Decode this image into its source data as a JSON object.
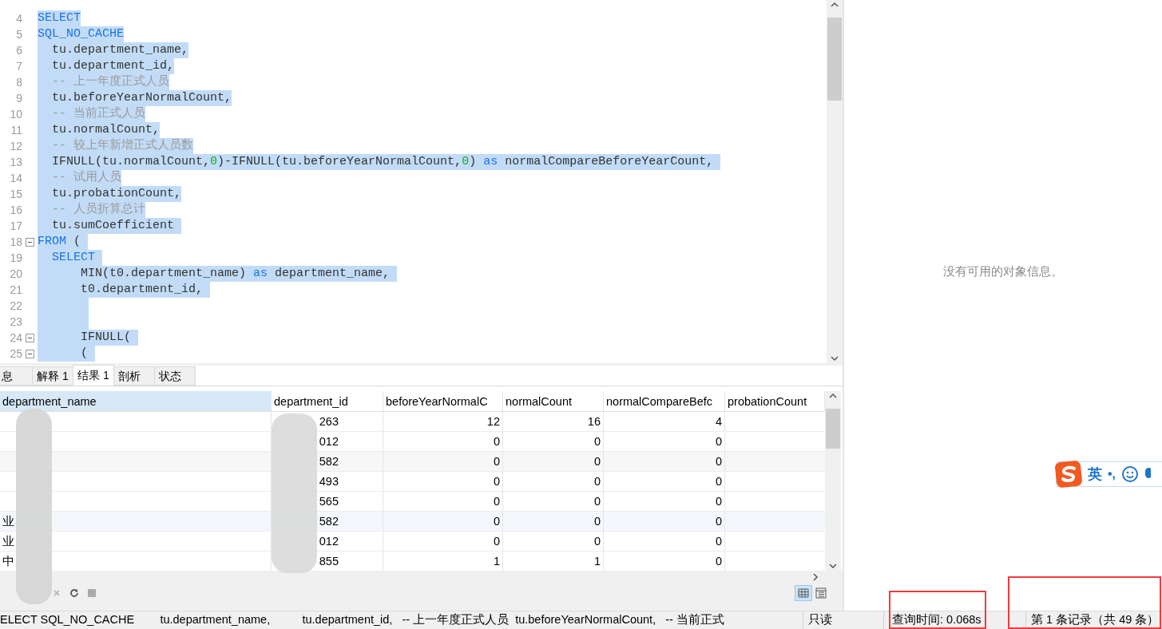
{
  "editor": {
    "lines": [
      {
        "number": "4",
        "selected": true,
        "fold": false,
        "segments": [
          {
            "kind": "keyword",
            "text": "SELECT"
          }
        ]
      },
      {
        "number": "5",
        "selected": true,
        "fold": false,
        "segments": [
          {
            "kind": "keyword",
            "text": "SQL_NO_CACHE"
          }
        ]
      },
      {
        "number": "6",
        "selected": true,
        "fold": false,
        "segments": [
          {
            "kind": "plain",
            "text": "  tu.department_name,"
          }
        ]
      },
      {
        "number": "7",
        "selected": true,
        "fold": false,
        "segments": [
          {
            "kind": "plain",
            "text": "  tu.department_id,"
          }
        ]
      },
      {
        "number": "8",
        "selected": true,
        "fold": false,
        "segments": [
          {
            "kind": "comment",
            "text": "  -- 上一年度正式人员"
          }
        ]
      },
      {
        "number": "9",
        "selected": true,
        "fold": false,
        "segments": [
          {
            "kind": "plain",
            "text": "  tu.beforeYearNormalCount,"
          }
        ]
      },
      {
        "number": "10",
        "selected": true,
        "fold": false,
        "segments": [
          {
            "kind": "comment",
            "text": "  -- 当前正式人员"
          }
        ]
      },
      {
        "number": "11",
        "selected": true,
        "fold": false,
        "segments": [
          {
            "kind": "plain",
            "text": "  tu.normalCount,"
          }
        ]
      },
      {
        "number": "12",
        "selected": true,
        "fold": false,
        "segments": [
          {
            "kind": "comment",
            "text": "  -- 较上年新增正式人员数"
          }
        ]
      },
      {
        "number": "13",
        "selected": true,
        "fold": false,
        "segments": [
          {
            "kind": "plain",
            "text": "  IFNULL(tu.normalCount,"
          },
          {
            "kind": "number",
            "text": "0"
          },
          {
            "kind": "plain",
            "text": ")-IFNULL(tu.beforeYearNormalCount,"
          },
          {
            "kind": "number",
            "text": "0"
          },
          {
            "kind": "plain",
            "text": ") "
          },
          {
            "kind": "keyword",
            "text": "as"
          },
          {
            "kind": "plain",
            "text": " normalCompareBeforeYearCount, "
          }
        ]
      },
      {
        "number": "14",
        "selected": true,
        "fold": false,
        "segments": [
          {
            "kind": "comment",
            "text": "  -- 试用人员"
          }
        ]
      },
      {
        "number": "15",
        "selected": true,
        "fold": false,
        "segments": [
          {
            "kind": "plain",
            "text": "  tu.probationCount,"
          }
        ]
      },
      {
        "number": "16",
        "selected": true,
        "fold": false,
        "segments": [
          {
            "kind": "comment",
            "text": "  -- 人员折算总计"
          }
        ]
      },
      {
        "number": "17",
        "selected": true,
        "fold": false,
        "segments": [
          {
            "kind": "plain",
            "text": "  tu.sumCoefficient "
          }
        ]
      },
      {
        "number": "18",
        "selected": true,
        "fold": true,
        "segments": [
          {
            "kind": "keyword",
            "text": "FROM"
          },
          {
            "kind": "plain",
            "text": " ( "
          }
        ]
      },
      {
        "number": "19",
        "selected": true,
        "fold": false,
        "segments": [
          {
            "kind": "keyword",
            "text": "  SELECT "
          }
        ]
      },
      {
        "number": "20",
        "selected": true,
        "fold": false,
        "segments": [
          {
            "kind": "plain",
            "text": "      MIN(t0.department_name) "
          },
          {
            "kind": "keyword",
            "text": "as"
          },
          {
            "kind": "plain",
            "text": " department_name, "
          }
        ]
      },
      {
        "number": "21",
        "selected": true,
        "fold": false,
        "segments": [
          {
            "kind": "plain",
            "text": "      t0.department_id, "
          }
        ]
      },
      {
        "number": "22",
        "selected": true,
        "fold": false
      },
      {
        "number": "23",
        "selected": true,
        "fold": false
      },
      {
        "number": "24",
        "selected": true,
        "fold": true,
        "segments": [
          {
            "kind": "plain",
            "text": "      IFNULL( "
          }
        ]
      },
      {
        "number": "25",
        "selected": true,
        "fold": true,
        "segments": [
          {
            "kind": "plain",
            "text": "      ( "
          }
        ]
      }
    ]
  },
  "info_panel": {
    "message": "没有可用的对象信息。"
  },
  "tabs": [
    {
      "label": "息",
      "selected": false
    },
    {
      "label": "解释 1",
      "selected": false
    },
    {
      "label": "结果 1",
      "selected": true
    },
    {
      "label": "剖析",
      "selected": false
    },
    {
      "label": "状态",
      "selected": false
    }
  ],
  "table": {
    "columns": [
      "department_name",
      "department_id",
      "beforeYearNormalC",
      "normalCount",
      "normalCompareBefc",
      "probationCount"
    ],
    "rows": [
      {
        "department_id": "263",
        "before": "12",
        "normal": "16",
        "compare": "4"
      },
      {
        "department_id": "012",
        "before": "0",
        "normal": "0",
        "compare": "0"
      },
      {
        "department_id": "582",
        "before": "0",
        "normal": "0",
        "compare": "0"
      },
      {
        "department_id": "493",
        "before": "0",
        "normal": "0",
        "compare": "0"
      },
      {
        "department_id": "565",
        "before": "0",
        "normal": "0",
        "compare": "0"
      },
      {
        "department_name": "业",
        "department_id": "582",
        "before": "0",
        "normal": "0",
        "compare": "0"
      },
      {
        "department_name": "业",
        "department_id": "012",
        "before": "0",
        "normal": "0",
        "compare": "0"
      },
      {
        "department_name": "中",
        "department_id": "855",
        "before": "1",
        "normal": "1",
        "compare": "0"
      }
    ]
  },
  "status_bar": {
    "query": "ELECT SQL_NO_CACHE        tu.department_name,          tu.department_id,   -- 上一年度正式人员  tu.beforeYearNormalCount,   -- 当前正式",
    "mode": "只读",
    "time": "查询时间: 0.068s",
    "records": "第 1 条记录（共 49 条）"
  },
  "ime_bar": {
    "language": "英",
    "punctuation": "•,"
  }
}
